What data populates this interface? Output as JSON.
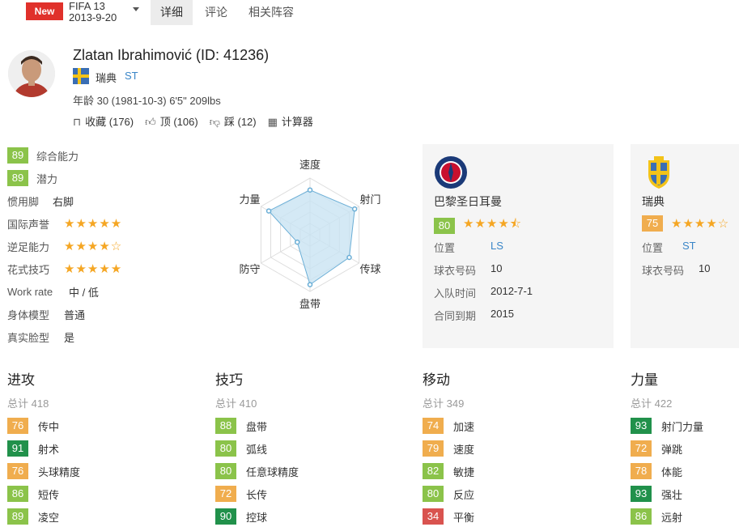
{
  "topbar": {
    "new_label": "New",
    "game": "FIFA 13",
    "date": "2013-9-20",
    "tabs": [
      "详细",
      "评论",
      "相关阵容"
    ]
  },
  "player": {
    "name": "Zlatan Ibrahimović (ID: 41236)",
    "nation": "瑞典",
    "position": "ST",
    "age_line": "年龄 30 (1981-10-3) 6'5\" 209lbs",
    "actions": {
      "favorite": "收藏 (176)",
      "up": "顶 (106)",
      "down": "踩 (12)",
      "calculator": "计算器"
    }
  },
  "summary": {
    "overall_value": "89",
    "overall_label": "综合能力",
    "potential_value": "89",
    "potential_label": "潜力",
    "foot_label": "惯用脚",
    "foot_value": "右脚",
    "rep_label": "国际声誉",
    "rep_stars": 5,
    "weakfoot_label": "逆足能力",
    "weakfoot_stars": 4,
    "skill_label": "花式技巧",
    "skill_stars": 5,
    "workrate_label": "Work rate",
    "workrate_value": "中 / 低",
    "body_label": "身体模型",
    "body_value": "普通",
    "face_label": "真实脸型",
    "face_value": "是"
  },
  "radar": {
    "labels": [
      "速度",
      "射门",
      "传球",
      "盘带",
      "防守",
      "力量"
    ],
    "values": [
      79,
      91,
      80,
      88,
      26,
      84
    ],
    "fill_color": "#c9e4f3",
    "stroke_color": "#6aaed6"
  },
  "club_card": {
    "name": "巴黎圣日耳曼",
    "rating": "80",
    "stars": 4.5,
    "pos_label": "位置",
    "pos_value": "LS",
    "shirt_label": "球衣号码",
    "shirt_value": "10",
    "join_label": "入队时间",
    "join_value": "2012-7-1",
    "contract_label": "合同到期",
    "contract_value": "2015"
  },
  "nation_card": {
    "name": "瑞典",
    "rating": "75",
    "stars": 4,
    "pos_label": "位置",
    "pos_value": "ST",
    "shirt_label": "球衣号码",
    "shirt_value": "10"
  },
  "categories": [
    {
      "title": "进攻",
      "total": "总计 418",
      "items": [
        {
          "v": "76",
          "n": "传中",
          "c": "b-or"
        },
        {
          "v": "91",
          "n": "射术",
          "c": "b-dg"
        },
        {
          "v": "76",
          "n": "头球精度",
          "c": "b-or"
        },
        {
          "v": "86",
          "n": "短传",
          "c": "b-lg"
        },
        {
          "v": "89",
          "n": "凌空",
          "c": "b-lg"
        }
      ]
    },
    {
      "title": "技巧",
      "total": "总计 410",
      "items": [
        {
          "v": "88",
          "n": "盘带",
          "c": "b-lg"
        },
        {
          "v": "80",
          "n": "弧线",
          "c": "b-lg"
        },
        {
          "v": "80",
          "n": "任意球精度",
          "c": "b-lg"
        },
        {
          "v": "72",
          "n": "长传",
          "c": "b-or"
        },
        {
          "v": "90",
          "n": "控球",
          "c": "b-dg"
        }
      ]
    },
    {
      "title": "移动",
      "total": "总计 349",
      "items": [
        {
          "v": "74",
          "n": "加速",
          "c": "b-or"
        },
        {
          "v": "79",
          "n": "速度",
          "c": "b-or"
        },
        {
          "v": "82",
          "n": "敏捷",
          "c": "b-lg"
        },
        {
          "v": "80",
          "n": "反应",
          "c": "b-lg"
        },
        {
          "v": "34",
          "n": "平衡",
          "c": "b-rd"
        }
      ]
    },
    {
      "title": "力量",
      "total": "总计 422",
      "items": [
        {
          "v": "93",
          "n": "射门力量",
          "c": "b-dg"
        },
        {
          "v": "72",
          "n": "弹跳",
          "c": "b-or"
        },
        {
          "v": "78",
          "n": "体能",
          "c": "b-or"
        },
        {
          "v": "93",
          "n": "强壮",
          "c": "b-dg"
        },
        {
          "v": "86",
          "n": "远射",
          "c": "b-lg"
        }
      ]
    }
  ]
}
